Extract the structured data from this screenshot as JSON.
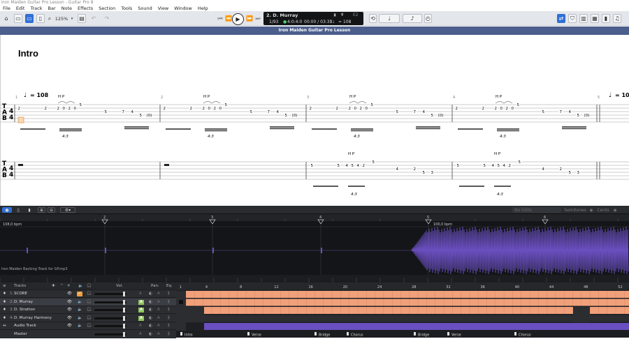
{
  "window": {
    "title": "Iron Maiden Guitar Pro Lesson - Guitar Pro 8"
  },
  "menu": [
    "File",
    "Edit",
    "Track",
    "Bar",
    "Note",
    "Effects",
    "Section",
    "Tools",
    "Sound",
    "View",
    "Window",
    "Help"
  ],
  "toolbar": {
    "zoom": "125%"
  },
  "lcd": {
    "track": "2. D. Murray",
    "position": "1/93",
    "signature": "4:0:4:0",
    "time": "00:00 / 03:35",
    "tempo_label": "= 108",
    "key": "E2"
  },
  "document": {
    "title": "Iron Maiden Guitar Pro Lesson"
  },
  "score": {
    "section": "Intro",
    "tempo_start": "= 108",
    "tempo_end": "= 100",
    "bar_numbers": [
      "1",
      "2",
      "3",
      "4",
      "5"
    ],
    "hp_label": "H P",
    "tuplet": "4:3",
    "tab_letters": [
      "T",
      "A",
      "B"
    ]
  },
  "audio": {
    "no_edits": "No Edits",
    "semitones": "Semitones",
    "cents": "Cents"
  },
  "wave": {
    "file": "Iron Maiden Backing Track for GP.mp3",
    "bpm_start": "108,0 bpm",
    "bpm_change": "100,0 bpm",
    "markers": [
      "2",
      "3",
      "4",
      "5",
      "6"
    ]
  },
  "tracks": {
    "header": "Tracks",
    "vol": "Vol.",
    "pan": "Pan.",
    "eq": "Eq.",
    "rows": [
      {
        "num": "1.",
        "name": "SCORE"
      },
      {
        "num": "2.",
        "name": "D. Murray"
      },
      {
        "num": "3.",
        "name": "D. Stratton"
      },
      {
        "num": "4.",
        "name": "D. Murray Harmony"
      },
      {
        "num": "",
        "name": "Audio Track"
      },
      {
        "num": "",
        "name": "Master"
      }
    ]
  },
  "timeline": {
    "bars": [
      "1",
      "4",
      "8",
      "12",
      "16",
      "20",
      "24",
      "28",
      "32",
      "36",
      "40",
      "44",
      "48",
      "52"
    ],
    "sections": [
      "Intro",
      "Verse",
      "Bridge",
      "Chorus",
      "Bridge",
      "Verse",
      "Chorus"
    ]
  },
  "colors": {
    "accent": "#2f6fd6",
    "header": "#4c5e8c",
    "track_block": "#f0a07a",
    "wave": "#6a4fc0"
  }
}
